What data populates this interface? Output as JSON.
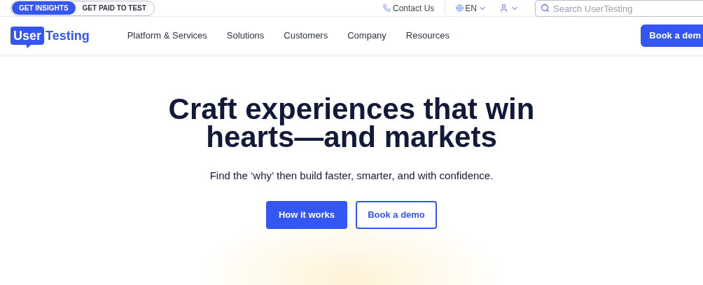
{
  "audience_toggle": [
    {
      "label": "GET INSIGHTS",
      "selected": true
    },
    {
      "label": "GET PAID TO TEST",
      "selected": false
    }
  ],
  "utility": {
    "contact": "Contact Us",
    "language": "EN",
    "search": {
      "placeholder": "Search UserTesting"
    }
  },
  "logo": {
    "part_1": "User",
    "part_2": "Testing"
  },
  "nav": [
    "Platform & Services",
    "Solutions",
    "Customers",
    "Company",
    "Resources"
  ],
  "nav_cta": "Book a dem",
  "hero": {
    "title_line_1": "Craft experiences that win",
    "title_line_2": "hearts—and markets",
    "subtitle": "Find the ‘why’ then build faster, smarter, and with confidence.",
    "buttons": [
      {
        "label": "How it works",
        "kind": "primary"
      },
      {
        "label": "Book a demo",
        "kind": "secondary"
      }
    ]
  }
}
